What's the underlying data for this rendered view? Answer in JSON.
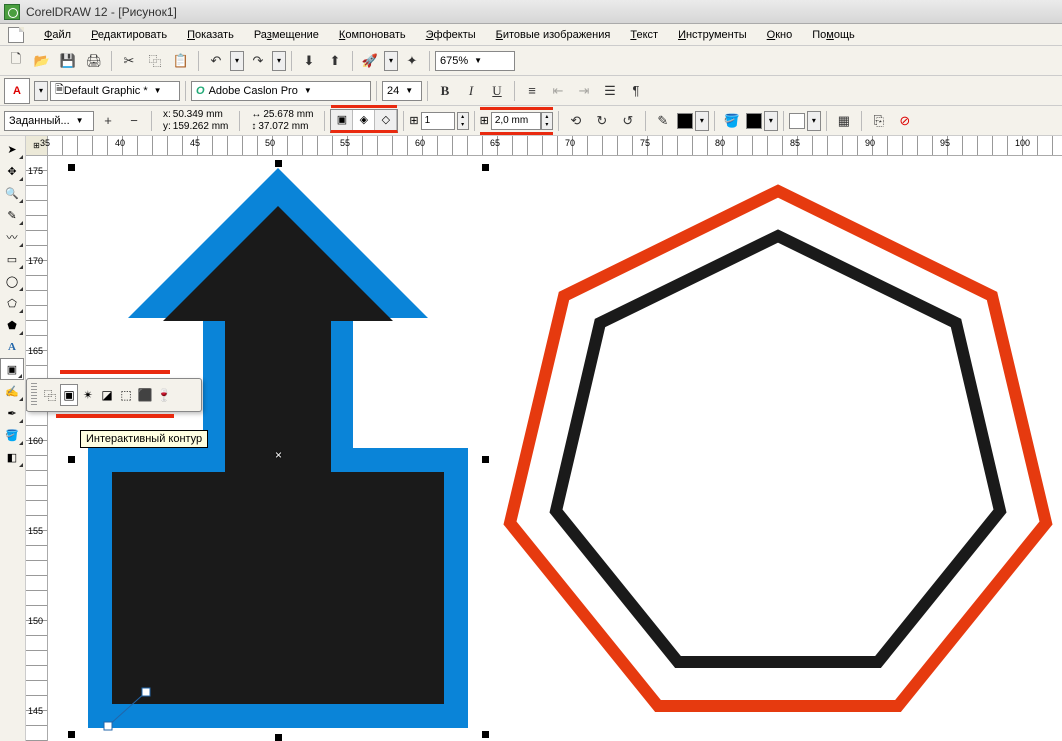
{
  "title": "CorelDRAW 12 - [Рисунок1]",
  "menu": {
    "file": "Файл",
    "edit": "Редактировать",
    "view": "Показать",
    "layout": "Размещение",
    "arrange": "Компоновать",
    "effects": "Эффекты",
    "bitmaps": "Битовые изображения",
    "text": "Текст",
    "tools": "Инструменты",
    "window": "Окно",
    "help": "Помощь"
  },
  "toolbar1": {
    "zoom": "675%"
  },
  "toolbar2": {
    "style_label": "A",
    "style": "Default Graphic *",
    "font": "Adobe Caslon Pro",
    "font_icon": "O",
    "font_size": "24",
    "bold": "B",
    "italic": "I",
    "underline": "U"
  },
  "toolbar3": {
    "preset": "Заданный...",
    "x_label": "x:",
    "y_label": "y:",
    "x": "50.349 mm",
    "y": "159.262 mm",
    "w_icon": "↔",
    "h_icon": "↕",
    "w": "25.678 mm",
    "h": "37.072 mm",
    "steps": "1",
    "offset": "2,0 mm",
    "offset_icon": "⊞"
  },
  "ruler_h": {
    "unit_box": "⊞",
    "labels": [
      "35",
      "40",
      "45",
      "50",
      "55",
      "60",
      "65",
      "70",
      "75",
      "80",
      "85",
      "90",
      "95",
      "100"
    ]
  },
  "ruler_v": {
    "labels": [
      "175",
      "170",
      "165",
      "160",
      "155",
      "150",
      "145"
    ]
  },
  "tooltip": "Интерактивный контур",
  "flyout_tools": [
    "blend-icon",
    "contour-icon",
    "distort-icon",
    "shadow-icon",
    "envelope-icon",
    "extrude-icon",
    "transparency-icon"
  ],
  "toolbox": [
    "pick-icon",
    "shape-icon",
    "zoom-icon",
    "freehand-icon",
    "smart-icon",
    "rectangle-icon",
    "ellipse-icon",
    "polygon-icon",
    "basic-shapes-icon",
    "text-icon",
    "interactive-icon",
    "eyedropper-icon",
    "outline-icon",
    "fill-icon",
    "interactive-fill-icon"
  ],
  "colors": {
    "arrow_fill": "#1a1a1a",
    "arrow_contour": "#0a84d8",
    "heptagon_outer": "#e63a0f",
    "heptagon_inner": "#1a1a1a"
  }
}
